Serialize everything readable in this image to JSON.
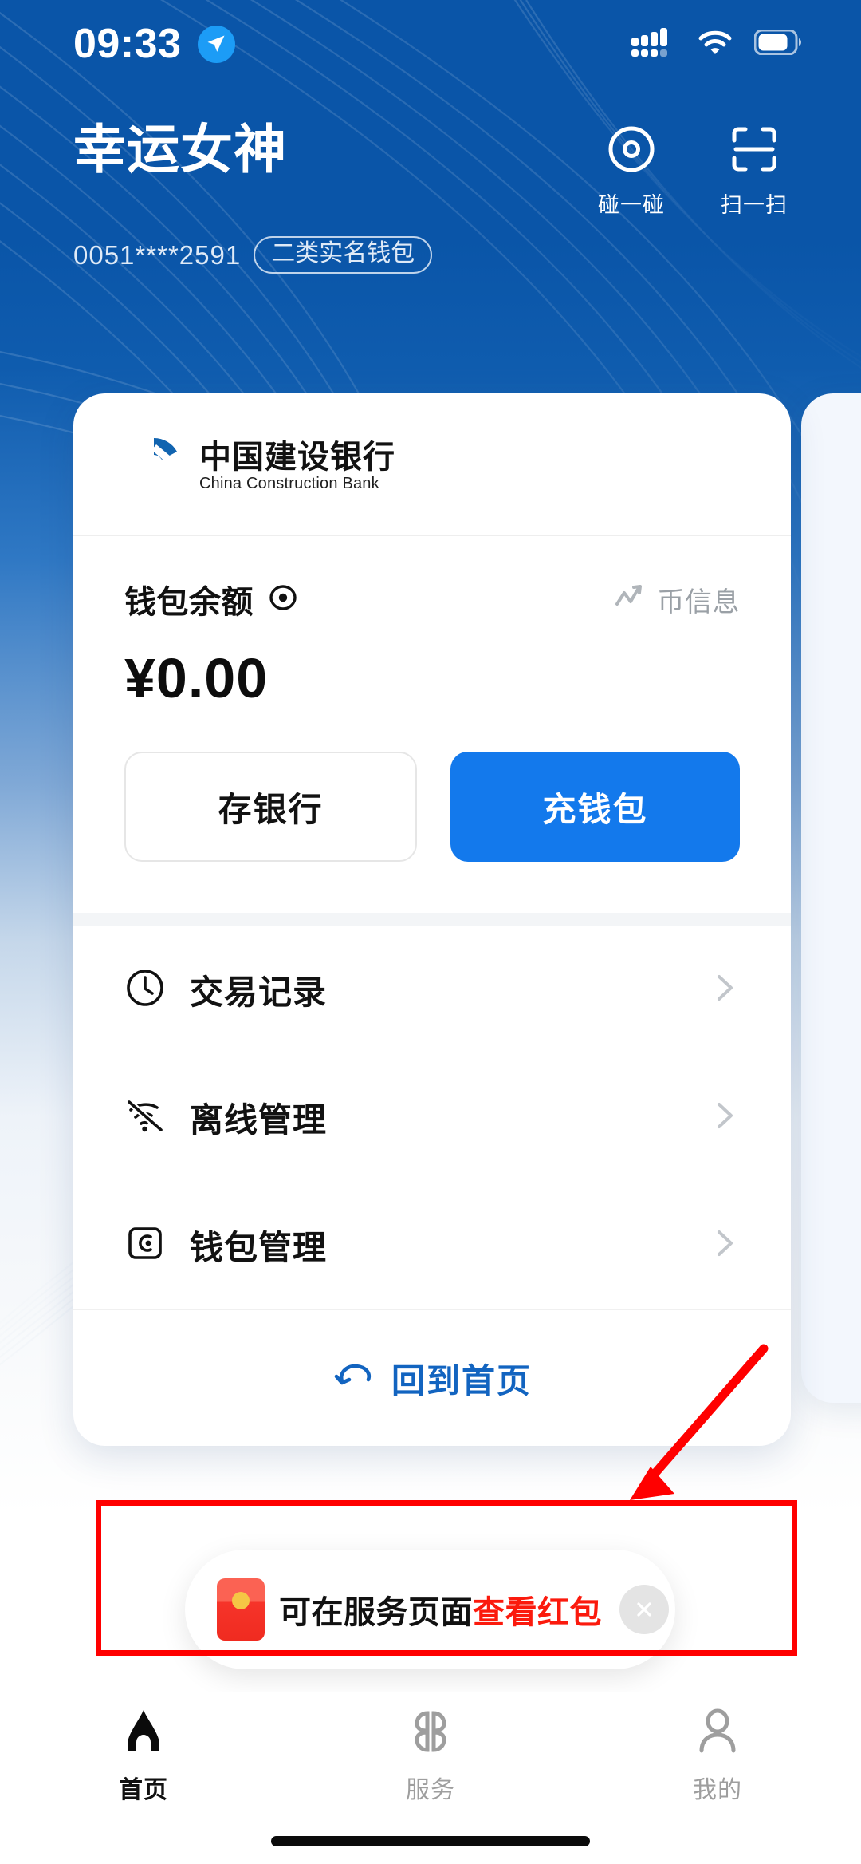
{
  "status_bar": {
    "time": "09:33",
    "location_icon": "location-arrow-icon",
    "signal_icon": "signal-bars-icon",
    "wifi_icon": "wifi-icon",
    "battery_icon": "battery-icon"
  },
  "header": {
    "user_name": "幸运女神",
    "account_number": "0051****2591",
    "account_badge": "二类实名钱包",
    "actions": [
      {
        "label": "碰一碰",
        "icon": "tap-circle-icon"
      },
      {
        "label": "扫一扫",
        "icon": "scan-frame-icon"
      }
    ]
  },
  "wallet_card": {
    "bank_name_cn": "中国建设银行",
    "bank_name_en": "China Construction Bank",
    "bank_logo_icon": "ccb-logo-icon",
    "balance_label": "钱包余额",
    "balance_eye_icon": "eye-icon",
    "coin_info_label": "币信息",
    "coin_info_icon": "trend-line-icon",
    "balance_amount": "¥0.00",
    "buttons": {
      "deposit": "存银行",
      "topup": "充钱包"
    },
    "menu": [
      {
        "label": "交易记录",
        "icon": "clock-icon",
        "chevron": "chevron-right-icon"
      },
      {
        "label": "离线管理",
        "icon": "wifi-off-icon",
        "chevron": "chevron-right-icon"
      },
      {
        "label": "钱包管理",
        "icon": "wallet-icon",
        "chevron": "chevron-right-icon"
      }
    ],
    "home_link": {
      "label": "回到首页",
      "icon": "curved-back-arrow-icon"
    }
  },
  "toast": {
    "icon": "red-envelope-icon",
    "text_normal": "可在服务页面",
    "text_highlight": "查看红包",
    "close_icon": "close-icon",
    "highlight_color": "#fb1a0d"
  },
  "annotation": {
    "box_color": "#ff0000",
    "arrow_color": "#ff0000"
  },
  "bottom_nav": {
    "items": [
      {
        "label": "首页",
        "icon": "home-icon",
        "active": true
      },
      {
        "label": "服务",
        "icon": "grid-icon",
        "active": false
      },
      {
        "label": "我的",
        "icon": "person-icon",
        "active": false
      }
    ]
  },
  "theme": {
    "brand_blue": "#0a55a8",
    "accent_blue": "#1379ec",
    "link_blue": "#1264c0"
  }
}
